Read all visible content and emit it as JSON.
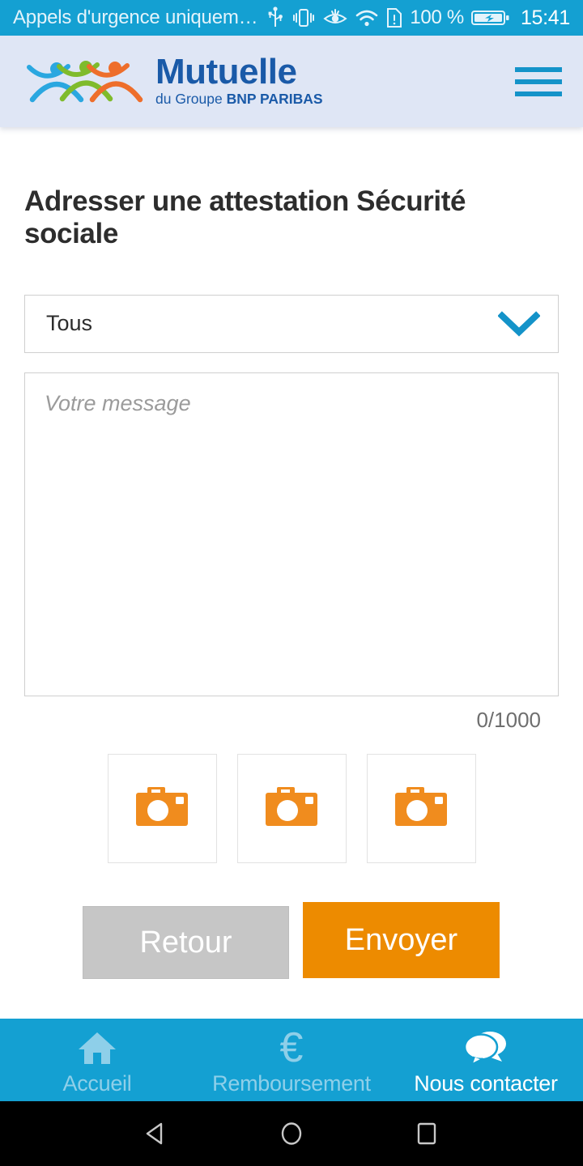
{
  "status_bar": {
    "carrier_text": "Appels d'urgence uniquem…",
    "usb_icon": "usb-icon",
    "vibrate_icon": "vibrate-icon",
    "eyecare_icon": "eye-comfort-icon",
    "wifi_icon": "wifi-icon",
    "sim_icon": "sim-alert-icon",
    "battery_percent": "100 %",
    "battery_icon": "battery-charging-icon",
    "time": "15:41",
    "background_color": "#14A0D2"
  },
  "app_header": {
    "logo_title": "Mutuelle",
    "logo_sub_prefix": "du Groupe ",
    "logo_sub_brand": "BNP PARIBAS",
    "logo_icon": "three-people-logo",
    "menu_icon": "hamburger-menu-icon",
    "background_color": "#dfe6f5",
    "brand_blue": "#1A5AA8",
    "accent_cyan": "#1493C9"
  },
  "main": {
    "page_title": "Adresser une attestation Sécurité sociale",
    "select": {
      "selected_value": "Tous",
      "chevron_icon": "chevron-down-icon",
      "options": [
        "Tous"
      ]
    },
    "message": {
      "placeholder": "Votre message",
      "value": "",
      "counter": "0/1000",
      "max_length": 1000
    },
    "attachments": {
      "slot_icon": "camera-icon",
      "slot_color": "#F08C1E",
      "slots": [
        "camera-slot-1",
        "camera-slot-2",
        "camera-slot-3"
      ]
    },
    "buttons": {
      "back_label": "Retour",
      "back_color": "#c6c6c6",
      "send_label": "Envoyer",
      "send_color": "#ED8B00"
    }
  },
  "bottom_nav": {
    "background_color": "#14A0D2",
    "items": [
      {
        "label": "Accueil",
        "icon": "home-icon",
        "active": false
      },
      {
        "label": "Remboursement",
        "icon": "euro-icon",
        "active": false
      },
      {
        "label": "Nous contacter",
        "icon": "chat-bubbles-icon",
        "active": true
      }
    ]
  },
  "android_nav": {
    "back_icon": "android-back-icon",
    "home_icon": "android-home-icon",
    "recents_icon": "android-recents-icon"
  }
}
